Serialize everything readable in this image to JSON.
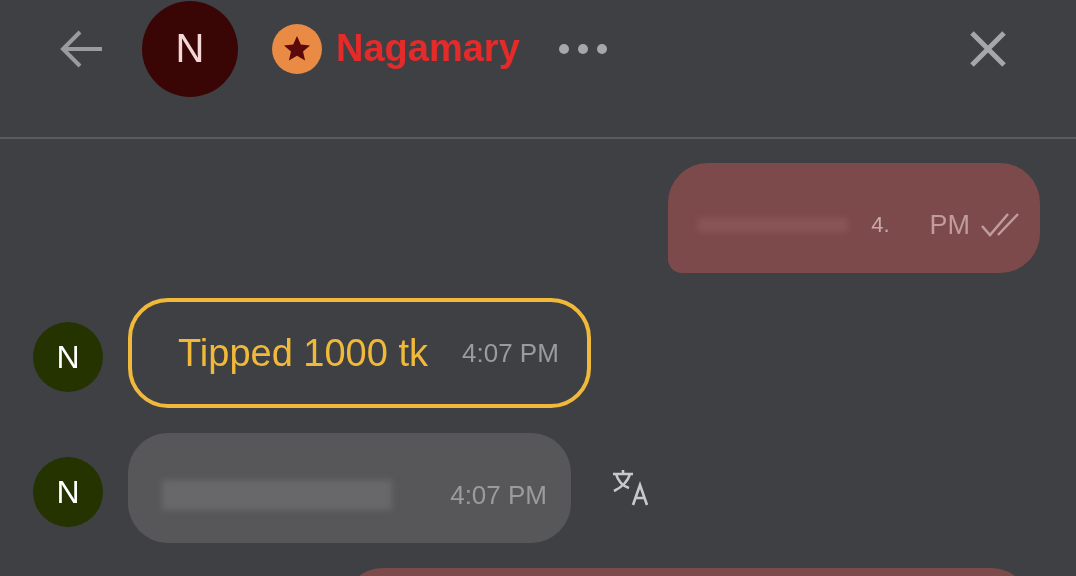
{
  "header": {
    "avatar_letter": "N",
    "name": "Nagamary",
    "has_badge": true
  },
  "messages": [
    {
      "kind": "sent",
      "fragment": "4.",
      "time": "PM",
      "read": true
    },
    {
      "kind": "tip",
      "avatar_letter": "N",
      "text": "Tipped 1000 tk",
      "time": "4:07 PM"
    },
    {
      "kind": "received",
      "avatar_letter": "N",
      "time": "4:07 PM",
      "translatable": true
    },
    {
      "kind": "sent_partial"
    }
  ]
}
